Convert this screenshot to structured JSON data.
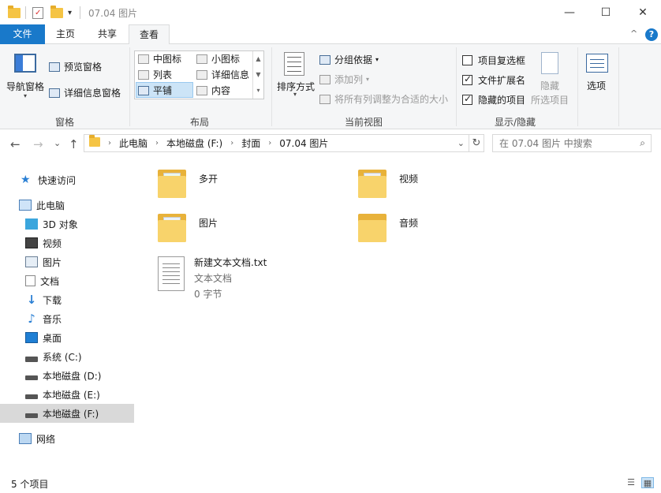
{
  "window": {
    "title": "07.04 图片",
    "dropdown_glyph": "▾",
    "minimize": "—",
    "maximize": "☐",
    "close": "✕"
  },
  "tabs": [
    {
      "label": "文件"
    },
    {
      "label": "主页"
    },
    {
      "label": "共享"
    },
    {
      "label": "查看"
    }
  ],
  "ribbon": {
    "collapse_glyph": "^",
    "help_glyph": "?",
    "panes": {
      "nav_pane_label": "导航窗格",
      "preview_pane_label": "预览窗格",
      "details_pane_label": "详细信息窗格",
      "group_label": "窗格"
    },
    "layout": {
      "items": [
        "中图标",
        "小图标",
        "列表",
        "详细信息",
        "平铺",
        "内容"
      ],
      "selected": "平铺",
      "group_label": "布局"
    },
    "current_view": {
      "sort_label": "排序方式",
      "group_by_label": "分组依据",
      "add_column_label": "添加列",
      "fit_columns_label": "将所有列调整为合适的大小",
      "group_label": "当前视图"
    },
    "show_hide": {
      "item_checkboxes_label": "项目复选框",
      "item_checkboxes_checked": false,
      "file_extensions_label": "文件扩展名",
      "file_extensions_checked": true,
      "hidden_items_label": "隐藏的项目",
      "hidden_items_checked": true,
      "hide_selected_label_1": "隐藏",
      "hide_selected_label_2": "所选项目",
      "group_label": "显示/隐藏"
    },
    "options_label": "选项"
  },
  "address": {
    "back": "←",
    "forward": "→",
    "recent": "⌄",
    "up": "↑",
    "crumbs": [
      "此电脑",
      "本地磁盘 (F:)",
      "封面",
      "07.04 图片"
    ],
    "crumb_sep": "›",
    "dropdown": "⌄",
    "refresh": "↻",
    "search_placeholder": "在 07.04 图片 中搜索",
    "search_glyph": "⌕"
  },
  "navpane": {
    "quick_access": "快速访问",
    "this_pc": "此电脑",
    "items": [
      {
        "label": "3D 对象",
        "icon": "cube-icon"
      },
      {
        "label": "视频",
        "icon": "film-icon"
      },
      {
        "label": "图片",
        "icon": "picture-icon"
      },
      {
        "label": "文档",
        "icon": "document-icon"
      },
      {
        "label": "下载",
        "icon": "download-icon"
      },
      {
        "label": "音乐",
        "icon": "music-icon"
      },
      {
        "label": "桌面",
        "icon": "desktop-icon"
      },
      {
        "label": "系统 (C:)",
        "icon": "drive-icon"
      },
      {
        "label": "本地磁盘 (D:)",
        "icon": "drive-icon"
      },
      {
        "label": "本地磁盘 (E:)",
        "icon": "drive-icon"
      },
      {
        "label": "本地磁盘 (F:)",
        "icon": "drive-icon"
      }
    ],
    "selected": "本地磁盘 (F:)",
    "network": "网络"
  },
  "content": {
    "items": [
      {
        "name": "多开",
        "type": "folder"
      },
      {
        "name": "视频",
        "type": "folder"
      },
      {
        "name": "图片",
        "type": "folder"
      },
      {
        "name": "音频",
        "type": "folder"
      },
      {
        "name": "新建文本文档.txt",
        "type": "file",
        "kind": "文本文档",
        "size": "0 字节"
      }
    ]
  },
  "status": {
    "count": "5 个项目"
  },
  "colors": {
    "accent": "#1979ca",
    "selection": "#cce4f7",
    "nav_selected": "#d9d9d9",
    "folder": "#f8d36b"
  }
}
